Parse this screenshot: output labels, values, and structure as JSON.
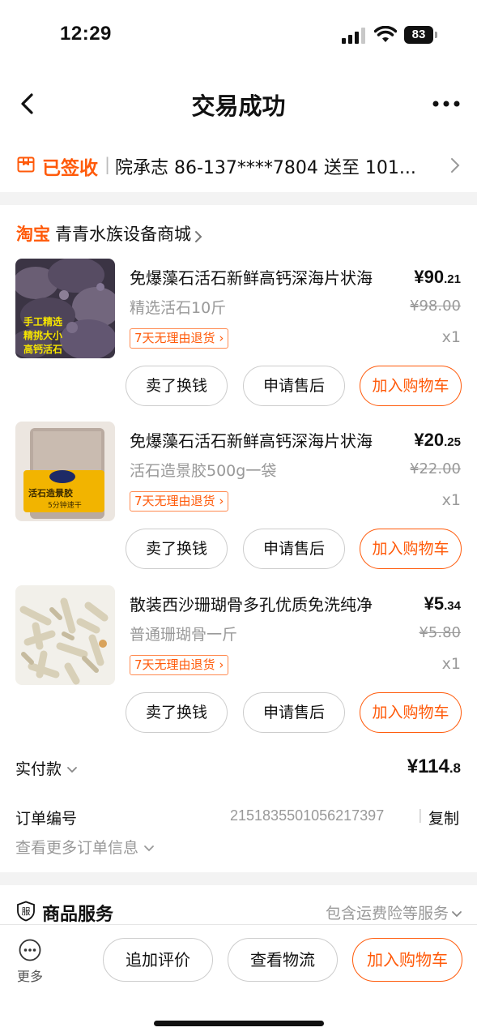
{
  "status_bar": {
    "time": "12:29",
    "battery": "83"
  },
  "nav": {
    "title": "交易成功"
  },
  "address": {
    "status": "已签收",
    "separator": "|",
    "text": "院承志 86-137****7804 送至 101..."
  },
  "shop": {
    "platform": "淘宝",
    "name": "青青水族设备商城"
  },
  "items": [
    {
      "name": "免爆藻石活石新鲜高钙深海片状海",
      "price_main": "¥90",
      "price_cents": ".21",
      "variant": "精选活石10斤",
      "original_price": "¥98.00",
      "tag": "7天无理由退货",
      "qty": "x1",
      "thumb_text": [
        "手工精选",
        "精挑大小",
        "高钙活石"
      ],
      "buttons": [
        "卖了换钱",
        "申请售后",
        "加入购物车"
      ]
    },
    {
      "name": "免爆藻石活石新鲜高钙深海片状海",
      "price_main": "¥20",
      "price_cents": ".25",
      "variant": "活石造景胶500g一袋",
      "original_price": "¥22.00",
      "tag": "7天无理由退货",
      "qty": "x1",
      "thumb_text": [
        "活石造景胶",
        "5分钟速干"
      ],
      "buttons": [
        "卖了换钱",
        "申请售后",
        "加入购物车"
      ]
    },
    {
      "name": "散装西沙珊瑚骨多孔优质免洗纯净",
      "price_main": "¥5",
      "price_cents": ".34",
      "variant": "普通珊瑚骨一斤",
      "original_price": "¥5.80",
      "tag": "7天无理由退货",
      "qty": "x1",
      "thumb_text": [],
      "buttons": [
        "卖了换钱",
        "申请售后",
        "加入购物车"
      ]
    }
  ],
  "payment": {
    "label": "实付款",
    "amount_main": "¥114",
    "amount_decimal": ".8"
  },
  "order": {
    "label": "订单编号",
    "number": "2151835501056217397",
    "separator": "|",
    "copy": "复制",
    "more_info": "查看更多订单信息"
  },
  "service": {
    "icon_char": "服",
    "title": "商品服务",
    "desc": "包含运费险等服务"
  },
  "bottom_bar": {
    "more": "更多",
    "buttons": [
      "追加评价",
      "查看物流",
      "加入购物车"
    ]
  },
  "colors": {
    "accent": "#ff5a0a",
    "muted": "#999999",
    "divider": "#f3f3f3"
  }
}
